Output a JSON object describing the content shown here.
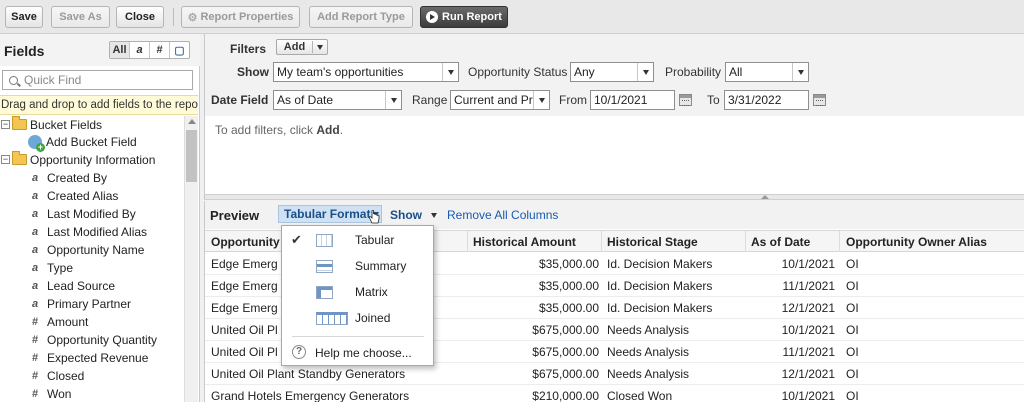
{
  "toolbar": {
    "save": "Save",
    "save_as": "Save As",
    "close": "Close",
    "report_properties": "Report Properties",
    "add_report_type": "Add Report Type",
    "run_report": "Run Report"
  },
  "fields_panel": {
    "title": "Fields",
    "filters": [
      "All",
      "a",
      "#",
      "▢"
    ],
    "quick_find_placeholder": "Quick Find",
    "drag_hint": "Drag and drop to add fields to the report.",
    "bucket_folder": "Bucket Fields",
    "add_bucket": "Add Bucket Field",
    "opp_folder": "Opportunity Information",
    "fields": [
      {
        "label": "Created By",
        "type": "text"
      },
      {
        "label": "Created Alias",
        "type": "text"
      },
      {
        "label": "Last Modified By",
        "type": "text"
      },
      {
        "label": "Last Modified Alias",
        "type": "text"
      },
      {
        "label": "Opportunity Name",
        "type": "text"
      },
      {
        "label": "Type",
        "type": "text"
      },
      {
        "label": "Lead Source",
        "type": "text"
      },
      {
        "label": "Primary Partner",
        "type": "text"
      },
      {
        "label": "Amount",
        "type": "number"
      },
      {
        "label": "Opportunity Quantity",
        "type": "number"
      },
      {
        "label": "Expected Revenue",
        "type": "number"
      },
      {
        "label": "Closed",
        "type": "number"
      },
      {
        "label": "Won",
        "type": "number"
      }
    ]
  },
  "filters": {
    "label": "Filters",
    "add": "Add",
    "show_label": "Show",
    "show_value": "My team's opportunities",
    "opp_status_label": "Opportunity Status",
    "opp_status_value": "Any",
    "probability_label": "Probability",
    "probability_value": "All",
    "date_field_label": "Date Field",
    "date_field_value": "As of Date",
    "range_label": "Range",
    "range_value": "Current and Pr",
    "from_label": "From",
    "from_value": "10/1/2021",
    "to_label": "To",
    "to_value": "3/31/2022",
    "hint_prefix": "To add filters, click ",
    "hint_bold": "Add",
    "hint_suffix": "."
  },
  "preview": {
    "title": "Preview",
    "format_button": "Tabular Format",
    "show": "Show",
    "remove_all": "Remove All Columns",
    "columns": [
      "Opportunity N",
      "Historical Amount",
      "Historical Stage",
      "As of Date",
      "Opportunity Owner Alias"
    ],
    "rows": [
      [
        "Edge Emerg",
        "$35,000.00",
        "Id. Decision Makers",
        "10/1/2021",
        "OI"
      ],
      [
        "Edge Emerg",
        "$35,000.00",
        "Id. Decision Makers",
        "11/1/2021",
        "OI"
      ],
      [
        "Edge Emerg",
        "$35,000.00",
        "Id. Decision Makers",
        "12/1/2021",
        "OI"
      ],
      [
        "United Oil Pl",
        "$675,000.00",
        "Needs Analysis",
        "10/1/2021",
        "OI"
      ],
      [
        "United Oil Pl",
        "$675,000.00",
        "Needs Analysis",
        "11/1/2021",
        "OI"
      ],
      [
        "United Oil Plant Standby Generators",
        "$675,000.00",
        "Needs Analysis",
        "12/1/2021",
        "OI"
      ],
      [
        "Grand Hotels Emergency Generators",
        "$210,000.00",
        "Closed Won",
        "10/1/2021",
        "OI"
      ]
    ]
  },
  "format_menu": {
    "items": [
      {
        "label": "Tabular",
        "checked": true,
        "icon": "tabular-icon"
      },
      {
        "label": "Summary",
        "checked": false,
        "icon": "summary-icon"
      },
      {
        "label": "Matrix",
        "checked": false,
        "icon": "matrix-icon"
      },
      {
        "label": "Joined",
        "checked": false,
        "icon": "joined-icon"
      }
    ],
    "help": "Help me choose..."
  }
}
